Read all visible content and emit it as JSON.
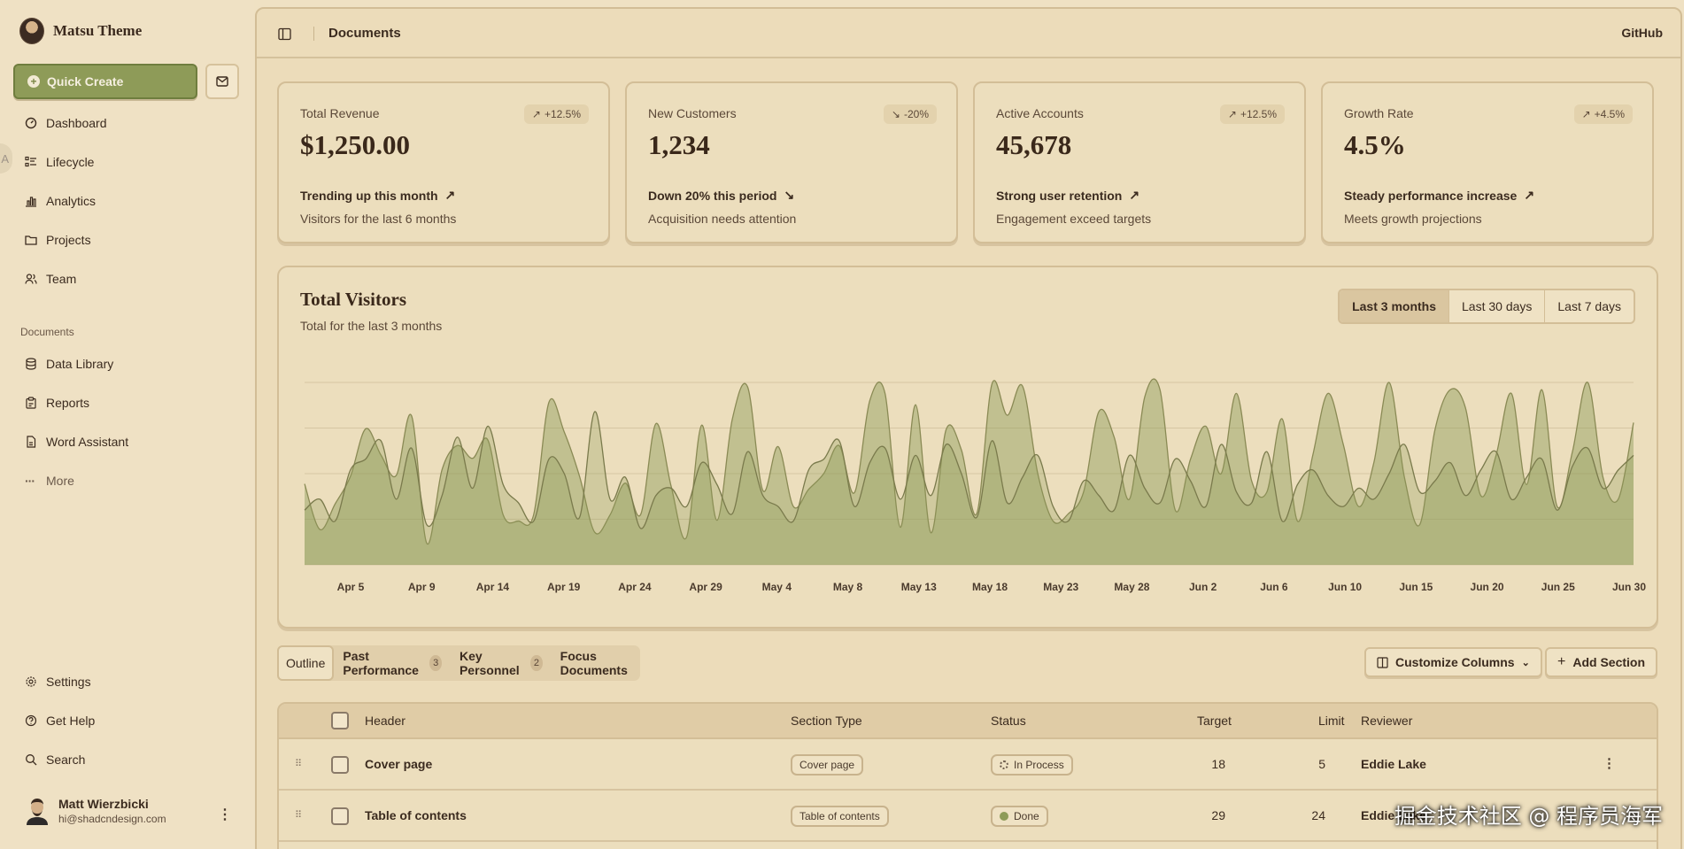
{
  "app": {
    "brand": "Matsu Theme"
  },
  "sidebar": {
    "quick_create": "Quick Create",
    "nav": [
      {
        "label": "Dashboard",
        "icon": "dashboard-icon"
      },
      {
        "label": "Lifecycle",
        "icon": "list-icon"
      },
      {
        "label": "Analytics",
        "icon": "bar-chart-icon"
      },
      {
        "label": "Projects",
        "icon": "folder-icon"
      },
      {
        "label": "Team",
        "icon": "users-icon"
      }
    ],
    "documents_title": "Documents",
    "documents": [
      {
        "label": "Data Library",
        "icon": "database-icon"
      },
      {
        "label": "Reports",
        "icon": "clipboard-icon"
      },
      {
        "label": "Word Assistant",
        "icon": "file-icon"
      },
      {
        "label": "More",
        "icon": "more-icon"
      }
    ],
    "footer": [
      {
        "label": "Settings",
        "icon": "gear-icon"
      },
      {
        "label": "Get Help",
        "icon": "help-icon"
      },
      {
        "label": "Search",
        "icon": "search-icon"
      }
    ],
    "user": {
      "name": "Matt Wierzbicki",
      "email": "hi@shadcndesign.com"
    }
  },
  "topbar": {
    "title": "Documents",
    "github": "GitHub"
  },
  "cards": [
    {
      "label": "Total Revenue",
      "value": "$1,250.00",
      "badge": "+12.5%",
      "trend": "Trending up this month",
      "note": "Visitors for the last 6 months",
      "dir": "up"
    },
    {
      "label": "New Customers",
      "value": "1,234",
      "badge": "-20%",
      "trend": "Down 20% this period",
      "note": "Acquisition needs attention",
      "dir": "down"
    },
    {
      "label": "Active Accounts",
      "value": "45,678",
      "badge": "+12.5%",
      "trend": "Strong user retention",
      "note": "Engagement exceed targets",
      "dir": "up"
    },
    {
      "label": "Growth Rate",
      "value": "4.5%",
      "badge": "+4.5%",
      "trend": "Steady performance increase",
      "note": "Meets growth projections",
      "dir": "up"
    }
  ],
  "chart": {
    "title": "Total Visitors",
    "subtitle": "Total for the last 3 months",
    "ranges": [
      "Last 3 months",
      "Last 30 days",
      "Last 7 days"
    ],
    "active_range": "Last 3 months"
  },
  "chart_data": {
    "type": "area",
    "title": "Total Visitors",
    "x_ticks": [
      "Apr 5",
      "Apr 9",
      "Apr 14",
      "Apr 19",
      "Apr 24",
      "Apr 29",
      "May 4",
      "May 8",
      "May 13",
      "May 18",
      "May 23",
      "May 28",
      "Jun 2",
      "Jun 6",
      "Jun 10",
      "Jun 15",
      "Jun 20",
      "Jun 25",
      "Jun 30"
    ],
    "ylim": [
      0,
      500
    ],
    "grid": true,
    "series": [
      {
        "values": [
          222,
          97,
          167,
          242,
          373,
          301,
          245,
          409,
          59,
          261,
          327,
          292,
          342,
          137,
          120,
          138,
          446,
          364,
          243,
          89,
          137,
          224,
          138,
          387,
          215,
          75,
          383,
          122,
          399,
          488,
          204,
          324,
          160,
          207,
          251,
          327,
          198,
          450,
          470,
          103,
          439,
          88,
          371,
          315,
          140,
          496,
          410,
          490,
          250,
          120,
          140,
          200,
          420,
          350,
          180,
          460,
          480,
          150,
          290,
          380,
          250,
          470,
          230,
          200,
          400,
          120,
          300,
          470,
          330,
          160,
          280,
          500,
          240,
          110,
          370,
          480,
          430,
          190,
          300,
          470,
          220,
          480,
          160,
          310,
          500,
          240,
          180,
          390
        ]
      },
      {
        "values": [
          150,
          180,
          120,
          260,
          290,
          340,
          180,
          320,
          110,
          190,
          350,
          210,
          380,
          220,
          170,
          120,
          290,
          250,
          130,
          420,
          180,
          240,
          100,
          190,
          210,
          160,
          280,
          220,
          140,
          310,
          190,
          160,
          120,
          260,
          290,
          340,
          160,
          280,
          320,
          180,
          300,
          190,
          330,
          250,
          130,
          340,
          170,
          240,
          300,
          160,
          120,
          230,
          190,
          150,
          300,
          210,
          170,
          290,
          230,
          160,
          330,
          200,
          170,
          310,
          120,
          220,
          260,
          190,
          160,
          210,
          180,
          250,
          330,
          200,
          230,
          280,
          190,
          260,
          310,
          180,
          240,
          290,
          150,
          270,
          320,
          210,
          260,
          300
        ]
      }
    ]
  },
  "table_tabs": [
    {
      "label": "Outline",
      "count": ""
    },
    {
      "label": "Past Performance",
      "count": "3"
    },
    {
      "label": "Key Personnel",
      "count": "2"
    },
    {
      "label": "Focus Documents",
      "count": ""
    }
  ],
  "actions": {
    "customize": "Customize Columns",
    "add_section": "Add Section"
  },
  "table": {
    "columns": [
      "Header",
      "Section Type",
      "Status",
      "Target",
      "Limit",
      "Reviewer"
    ],
    "rows": [
      {
        "header": "Cover page",
        "type": "Cover page",
        "status": "In Process",
        "target": "18",
        "limit": "5",
        "reviewer": "Eddie Lake"
      },
      {
        "header": "Table of contents",
        "type": "Table of contents",
        "status": "Done",
        "target": "29",
        "limit": "24",
        "reviewer": "Eddie Lake"
      }
    ]
  },
  "watermark": "掘金技术社区 @ 程序员海军"
}
